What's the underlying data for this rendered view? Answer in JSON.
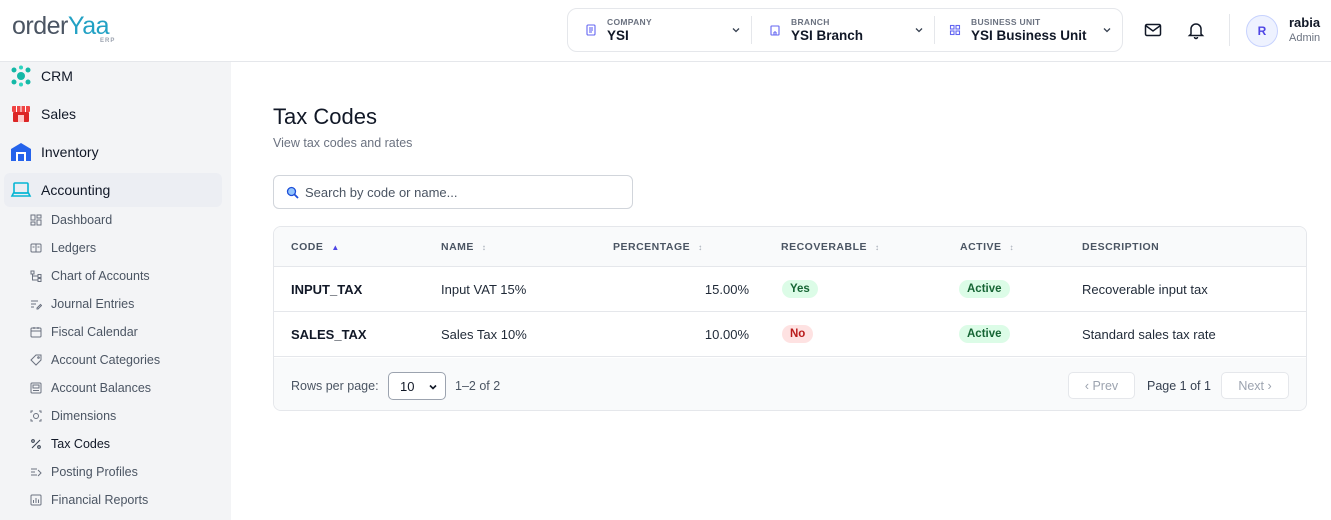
{
  "app": {
    "logo_text_a": "order",
    "logo_text_b": "Yaa",
    "logo_sub": "ERP"
  },
  "header": {
    "company_label": "COMPANY",
    "company_value": "YSI",
    "branch_label": "BRANCH",
    "branch_value": "YSI Branch",
    "bu_label": "BUSINESS UNIT",
    "bu_value": "YSI Business Unit",
    "user_initial": "R",
    "user_name": "rabia",
    "user_role": "Admin"
  },
  "sidebar": {
    "crm": "CRM",
    "sales": "Sales",
    "inventory": "Inventory",
    "accounting": "Accounting",
    "sub_items": [
      "Dashboard",
      "Ledgers",
      "Chart of Accounts",
      "Journal Entries",
      "Fiscal Calendar",
      "Account Categories",
      "Account Balances",
      "Dimensions",
      "Tax Codes",
      "Posting Profiles",
      "Financial Reports"
    ]
  },
  "page": {
    "title": "Tax Codes",
    "subtitle": "View tax codes and rates",
    "search_placeholder": "Search by code or name..."
  },
  "table": {
    "columns": [
      "CODE",
      "NAME",
      "PERCENTAGE",
      "RECOVERABLE",
      "ACTIVE",
      "DESCRIPTION"
    ],
    "rows": [
      {
        "code": "INPUT_TAX",
        "name": "Input VAT 15%",
        "percentage": "15.00%",
        "recoverable": "Yes",
        "active": "Active",
        "description": "Recoverable input tax"
      },
      {
        "code": "SALES_TAX",
        "name": "Sales Tax 10%",
        "percentage": "10.00%",
        "recoverable": "No",
        "active": "Active",
        "description": "Standard sales tax rate"
      }
    ]
  },
  "pagination": {
    "rows_per_page_label": "Rows per page:",
    "rows_per_page_value": "10",
    "range": "1–2 of 2",
    "prev": "‹ Prev",
    "page_info": "Page 1 of 1",
    "next": "Next ›"
  },
  "colors": {
    "accent": "#4f46e5",
    "green_badge_bg": "#dcfce7",
    "red_badge_bg": "#fee2e2"
  }
}
